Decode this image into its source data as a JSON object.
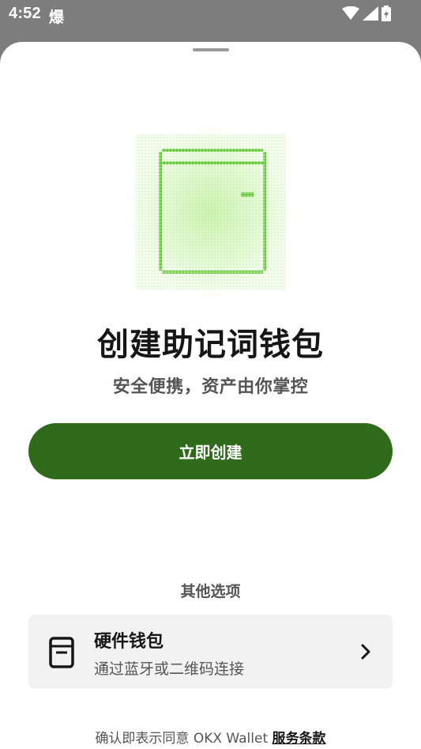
{
  "status_bar": {
    "time": "4:52",
    "app_glyph": "爆",
    "icons": [
      "wifi-icon",
      "cellular-signal-icon",
      "battery-charging-icon"
    ]
  },
  "sheet": {
    "illustration": "pixel-wallet-icon",
    "title": "创建助记词钱包",
    "subtitle": "安全便携，资产由你掌控",
    "primary_button": "立即创建",
    "other_options_label": "其他选项",
    "hardware_wallet": {
      "icon": "hardware-wallet-icon",
      "title": "硬件钱包",
      "description": "通过蓝牙或二维码连接",
      "chevron": "chevron-right-icon"
    },
    "terms": {
      "prefix": "确认即表示同意 OKX Wallet ",
      "link": "服务条款"
    }
  },
  "colors": {
    "primary_button": "#2f6b1a",
    "illustration_green": "#6fcf3a",
    "status_bar_bg": "#7d7d7d"
  }
}
